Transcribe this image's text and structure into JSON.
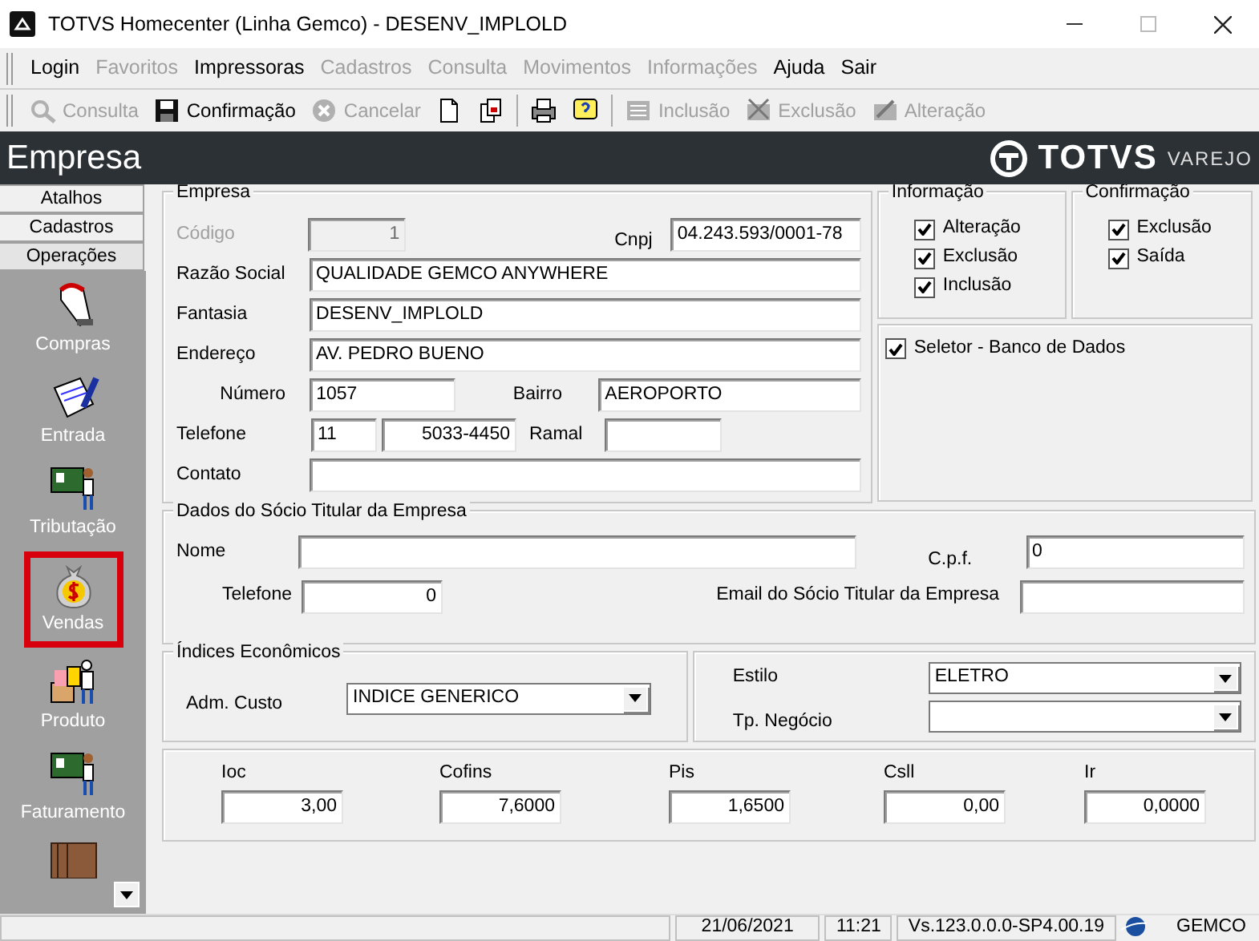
{
  "window": {
    "title": "TOTVS Homecenter (Linha Gemco) - DESENV_IMPLOLD"
  },
  "menu": [
    {
      "label": "Login",
      "disabled": false
    },
    {
      "label": "Favoritos",
      "disabled": true
    },
    {
      "label": "Impressoras",
      "disabled": false
    },
    {
      "label": "Cadastros",
      "disabled": true
    },
    {
      "label": "Consulta",
      "disabled": true
    },
    {
      "label": "Movimentos",
      "disabled": true
    },
    {
      "label": "Informações",
      "disabled": true
    },
    {
      "label": "Ajuda",
      "disabled": false
    },
    {
      "label": "Sair",
      "disabled": false
    }
  ],
  "toolbar": [
    {
      "kind": "button",
      "label": "Consulta",
      "disabled": true
    },
    {
      "kind": "button",
      "label": "Confirmação",
      "disabled": false
    },
    {
      "kind": "button",
      "label": "Cancelar",
      "disabled": true
    },
    {
      "kind": "tool"
    },
    {
      "kind": "tool"
    },
    {
      "kind": "separator"
    },
    {
      "kind": "tool"
    },
    {
      "kind": "tool"
    },
    {
      "kind": "separator"
    },
    {
      "kind": "button",
      "label": "Inclusão",
      "disabled": true
    },
    {
      "kind": "button",
      "label": "Exclusão",
      "disabled": true
    },
    {
      "kind": "button",
      "label": "Alteração",
      "disabled": true
    }
  ],
  "header": {
    "title": "Empresa",
    "brand": "TOTVS",
    "brand_suffix": "VAREJO"
  },
  "sidebar": {
    "tabs": [
      {
        "label": "Atalhos",
        "selected": false
      },
      {
        "label": "Cadastros",
        "selected": false
      },
      {
        "label": "Operações",
        "selected": true
      }
    ],
    "items": [
      {
        "label": "Compras",
        "selected": false
      },
      {
        "label": "Entrada",
        "selected": false
      },
      {
        "label": "Tributação",
        "selected": false
      },
      {
        "label": "Vendas",
        "selected": true
      },
      {
        "label": "Produto",
        "selected": false
      },
      {
        "label": "Faturamento",
        "selected": false
      }
    ]
  },
  "empresa": {
    "title": "Empresa",
    "fields": [
      {
        "label": "Código",
        "value": "1",
        "disabled": true
      },
      {
        "label": "Cnpj",
        "value": "04.243.593/0001-78",
        "disabled": false
      },
      {
        "label": "Razão Social",
        "value": "QUALIDADE GEMCO ANYWHERE",
        "disabled": false
      },
      {
        "label": "Fantasia",
        "value": "DESENV_IMPLOLD",
        "disabled": false
      },
      {
        "label": "Endereço",
        "value": "AV. PEDRO BUENO",
        "disabled": false
      },
      {
        "label": "Número",
        "value": "1057",
        "disabled": false
      },
      {
        "label": "Bairro",
        "value": "AEROPORTO",
        "disabled": false
      },
      {
        "label": "Telefone",
        "value": "11",
        "value_2": "5033-4450",
        "disabled": false
      },
      {
        "label": "Ramal",
        "disabled": false
      },
      {
        "label": "Contato",
        "disabled": false
      }
    ]
  },
  "informacao": {
    "title": "Informação",
    "options": [
      {
        "label": "Alteração",
        "checked": true
      },
      {
        "label": "Exclusão",
        "checked": true
      },
      {
        "label": "Inclusão",
        "checked": true
      }
    ]
  },
  "confirmacao": {
    "title": "Confirmação",
    "options": [
      {
        "label": "Exclusão",
        "checked": true
      },
      {
        "label": "Saída",
        "checked": true
      }
    ]
  },
  "seletor": {
    "label": "Seletor - Banco de Dados",
    "checked": true
  },
  "socio": {
    "title": "Dados do Sócio Titular da Empresa",
    "fields": [
      {
        "label": "Nome"
      },
      {
        "label": "C.p.f.",
        "value": "0"
      },
      {
        "label": "Telefone",
        "value": "0"
      },
      {
        "label": "Email do Sócio Titular da Empresa"
      }
    ]
  },
  "indices": {
    "title": "Índices Econômicos",
    "fields": [
      {
        "label": "Adm. Custo",
        "value": "INDICE GENERICO"
      }
    ]
  },
  "estilo": {
    "fields": [
      {
        "label": "Estilo",
        "value": "ELETRO"
      },
      {
        "label": "Tp. Negócio"
      }
    ]
  },
  "impostos": [
    {
      "label": "Ioc",
      "value": "3,00"
    },
    {
      "label": "Cofins",
      "value": "7,6000"
    },
    {
      "label": "Pis",
      "value": "1,6500"
    },
    {
      "label": "Csll",
      "value": "0,00"
    },
    {
      "label": "Ir",
      "value": "0,0000"
    }
  ],
  "status_bar": {
    "date": "21/06/2021",
    "time": "11:21",
    "version": "Vs.123.0.0.0-SP4.00.19",
    "user": "GEMCO"
  }
}
